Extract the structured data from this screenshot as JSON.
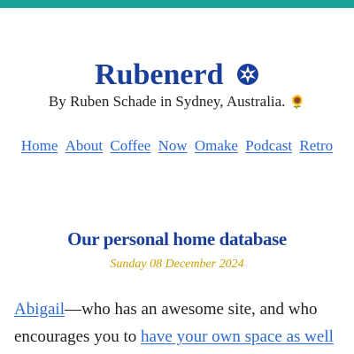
{
  "colors": {
    "topbar": "#1aa198",
    "title": "#1a3f99",
    "link": "#2a6ad4",
    "date": "#c7a000"
  },
  "site": {
    "title": "Rubenerd",
    "title_icon": "gear-star-icon",
    "byline": "By Ruben Schade in Sydney, Australia.",
    "byline_icon": "sunflower-icon"
  },
  "nav": {
    "items": [
      {
        "label": "Home"
      },
      {
        "label": "About"
      },
      {
        "label": "Coffee"
      },
      {
        "label": "Now"
      },
      {
        "label": "Omake"
      },
      {
        "label": "Podcast"
      },
      {
        "label": "Retro"
      }
    ]
  },
  "post": {
    "title": "Our personal home database",
    "date": "Sunday 08 December 2024",
    "body_link1": "Abigail",
    "body_text1": "—who has an awesome site, and who encourages you to ",
    "body_link2": "have your own space as well"
  }
}
